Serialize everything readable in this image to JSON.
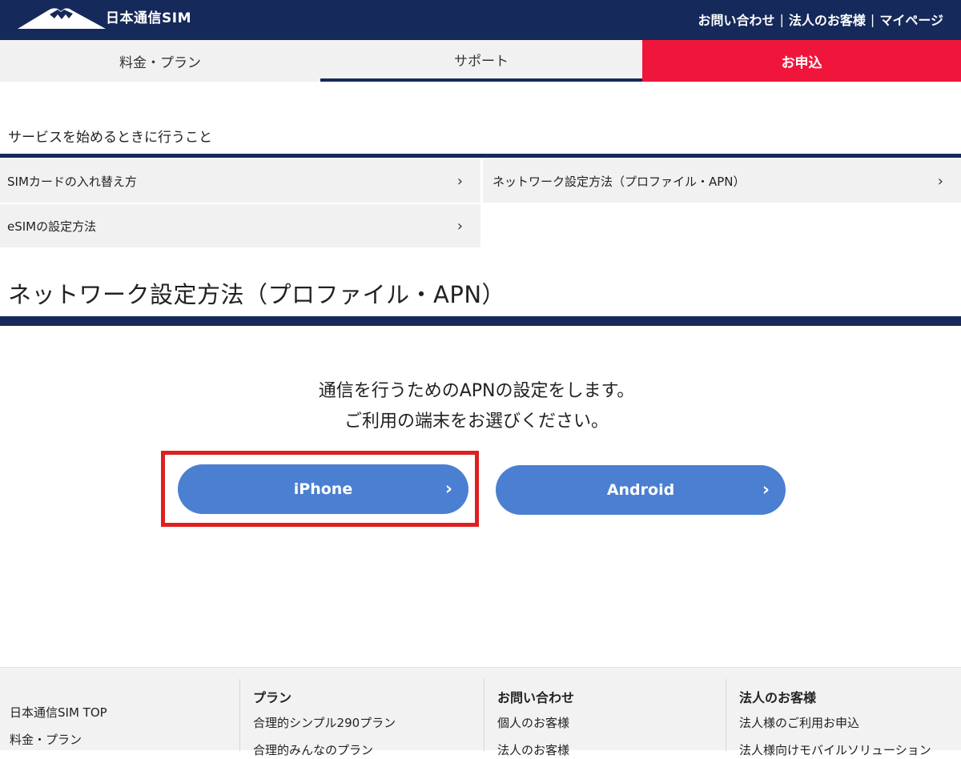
{
  "header": {
    "brand": "日本通信SIM",
    "links": [
      "お問い合わせ",
      "法人のお客様",
      "マイページ"
    ],
    "separator": "|"
  },
  "nav": {
    "tabs": [
      {
        "label": "料金・プラン"
      },
      {
        "label": "サポート",
        "active": true
      },
      {
        "label": "お申込"
      }
    ]
  },
  "section": {
    "heading": "サービスを始めるときに行うこと",
    "links": [
      {
        "label": "SIMカードの入れ替え方"
      },
      {
        "label": "ネットワーク設定方法（プロファイル・APN）"
      },
      {
        "label": "eSIMの設定方法"
      }
    ],
    "chevron": "›"
  },
  "page": {
    "title": "ネットワーク設定方法（プロファイル・APN）",
    "instruction_line1": "通信を行うためのAPNの設定をします。",
    "instruction_line2": "ご利用の端末をお選びください。",
    "buttons": [
      {
        "label": "iPhone",
        "highlighted": true
      },
      {
        "label": "Android"
      }
    ]
  },
  "footer": {
    "col1": {
      "items": [
        "日本通信SIM TOP",
        "料金・プラン"
      ]
    },
    "col2": {
      "head": "プラン",
      "items": [
        "合理的シンプル290プラン",
        "合理的みんなのプラン"
      ]
    },
    "col3": {
      "head": "お問い合わせ",
      "items": [
        "個人のお客様",
        "法人のお客様"
      ]
    },
    "col4": {
      "head": "法人のお客様",
      "items": [
        "法人様のご利用お申込",
        "法人様向けモバイルソリューション"
      ]
    }
  },
  "colors": {
    "navy": "#15295a",
    "apply_red": "#f0163b",
    "button_blue": "#4b7fd1",
    "highlight_red": "#e01e1e"
  }
}
